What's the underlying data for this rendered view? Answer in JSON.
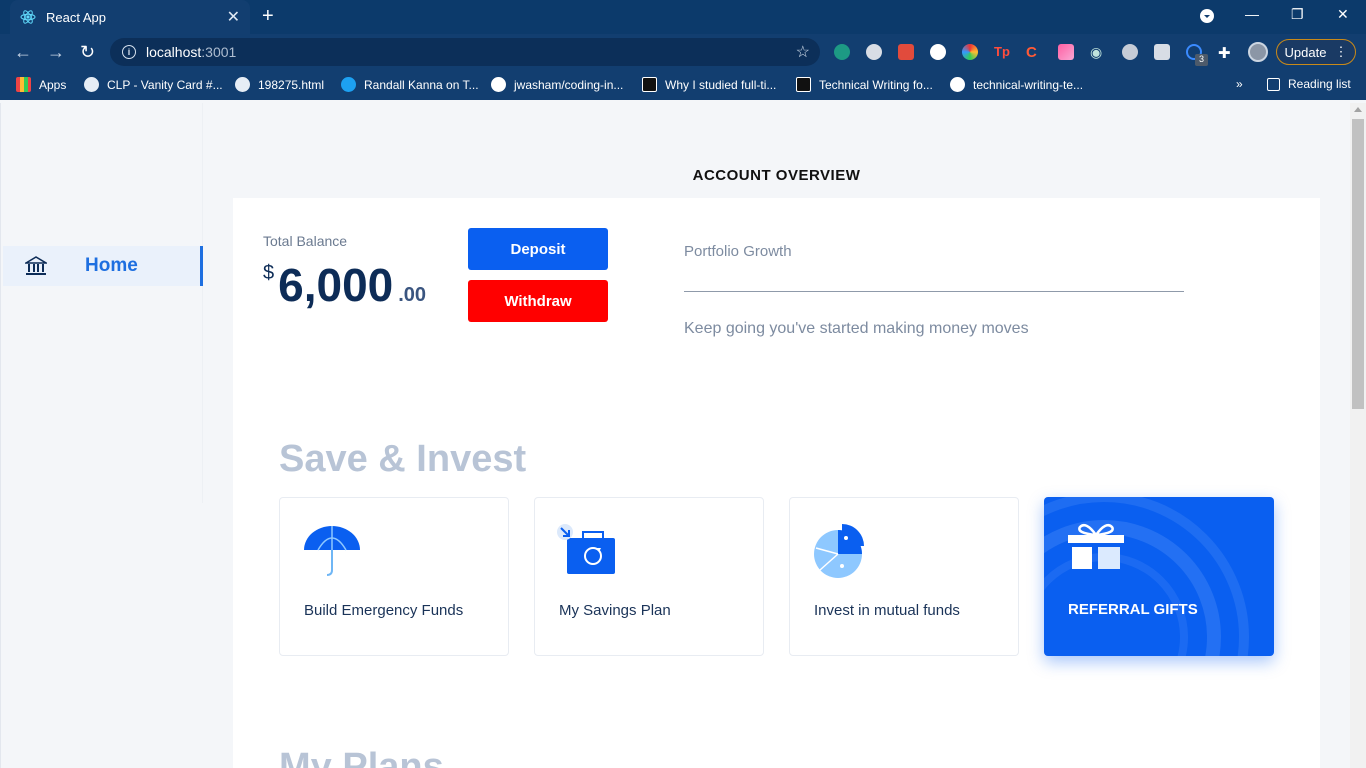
{
  "browser": {
    "tab_title": "React App",
    "url_host": "localhost",
    "url_port": ":3001",
    "update_label": "Update",
    "extension_badge": "3",
    "bookmarks": [
      {
        "label": "Apps"
      },
      {
        "label": "CLP - Vanity Card #..."
      },
      {
        "label": "198275.html"
      },
      {
        "label": "Randall Kanna on T..."
      },
      {
        "label": "jwasham/coding-in..."
      },
      {
        "label": "Why I studied full-ti..."
      },
      {
        "label": "Technical Writing fo..."
      },
      {
        "label": "technical-writing-te..."
      }
    ],
    "more_bookmarks": "»",
    "reading_list": "Reading list"
  },
  "sidebar": {
    "items": [
      {
        "label": "Home",
        "icon": "bank-icon"
      }
    ]
  },
  "page": {
    "title": "ACCOUNT OVERVIEW",
    "balance": {
      "label": "Total Balance",
      "currency": "$",
      "amount": "6,000",
      "cents": ".00"
    },
    "actions": {
      "deposit": "Deposit",
      "withdraw": "Withdraw"
    },
    "portfolio": {
      "label": "Portfolio Growth",
      "message": "Keep going you've started making money moves"
    },
    "save_invest": {
      "title": "Save & Invest",
      "tiles": [
        {
          "label": "Build Emergency Funds",
          "icon": "umbrella-icon"
        },
        {
          "label": "My Savings Plan",
          "icon": "savings-bag-icon"
        },
        {
          "label": "Invest in mutual funds",
          "icon": "pie-chart-icon"
        },
        {
          "label": "REFERRAL GIFTS",
          "icon": "gift-icon"
        }
      ]
    },
    "next_section_title": "My Plans"
  },
  "colors": {
    "primary": "#0a5ff0",
    "danger": "#ff0000",
    "browser_bg": "#123e70",
    "heading_navy": "#0d2c57"
  }
}
